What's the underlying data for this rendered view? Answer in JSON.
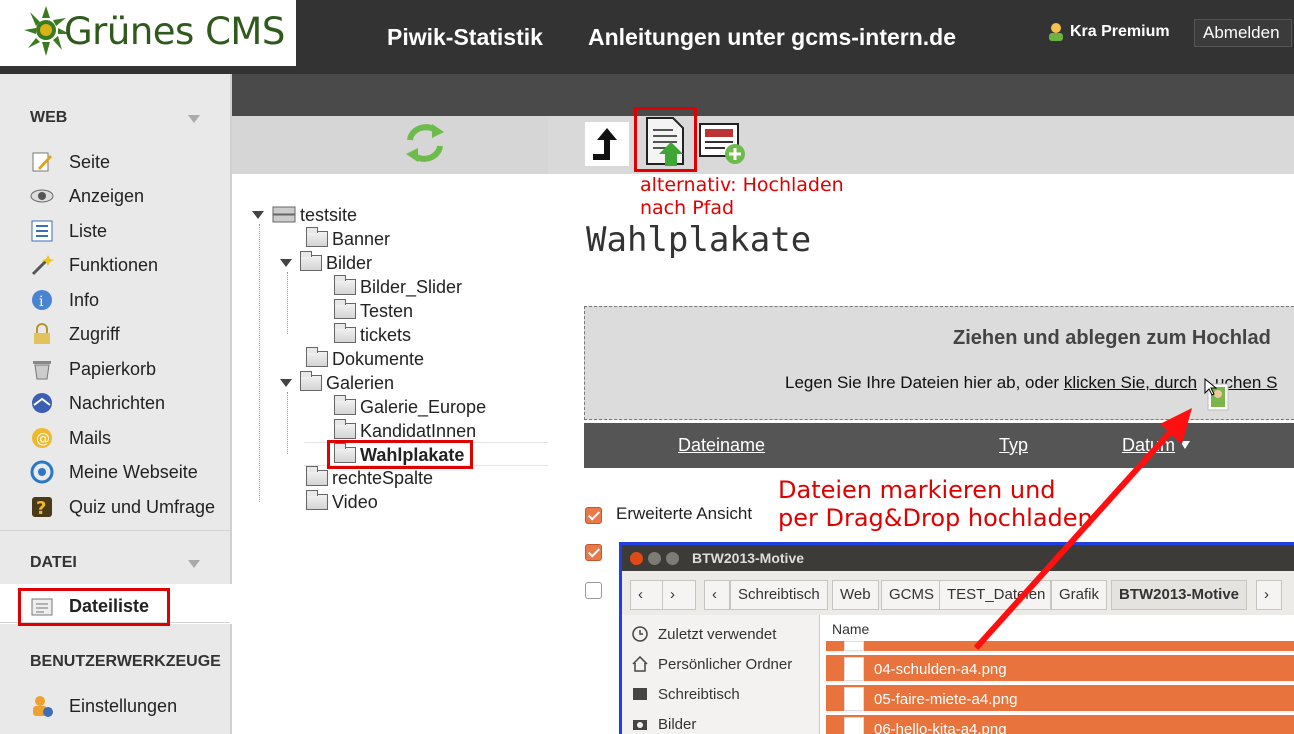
{
  "header": {
    "logo_text": "Grünes CMS",
    "nav": [
      "Piwik-Statistik",
      "Anleitungen unter gcms-intern.de"
    ],
    "user": "Kra Premium",
    "logout": "Abmelden"
  },
  "sidebar": {
    "section_web": "WEB",
    "web_items": [
      "Seite",
      "Anzeigen",
      "Liste",
      "Funktionen",
      "Info",
      "Zugriff",
      "Papierkorb",
      "Nachrichten",
      "Mails",
      "Meine Webseite",
      "Quiz und Umfrage"
    ],
    "section_datei": "DATEI",
    "datei_items": [
      "Dateiliste"
    ],
    "section_tools": "BENUTZERWERKZEUGE",
    "tools_items": [
      "Einstellungen"
    ]
  },
  "tree": {
    "root": "testsite",
    "items": [
      "Banner",
      "Bilder",
      "Bilder_Slider",
      "Testen",
      "tickets",
      "Dokumente",
      "Galerien",
      "Galerie_Europe",
      "KandidatInnen",
      "Wahlplakate",
      "rechteSpalte",
      "Video"
    ]
  },
  "annotations": {
    "upload_path_1": "alternativ: Hochladen",
    "upload_path_2": "nach Pfad",
    "drag_1": "Dateien markieren und",
    "drag_2": "per Drag&Drop hochladen"
  },
  "content": {
    "title": "Wahlplakate",
    "dropzone_title": "Ziehen und ablegen zum Hochlad",
    "dropzone_text_prefix": "Legen Sie Ihre Dateien hier ab, oder ",
    "dropzone_link": "klicken Sie, durch",
    "dropzone_link_end": "uchen S",
    "table_headers": [
      "Dateiname",
      "Typ",
      "Datum"
    ],
    "extended_view": "Erweiterte Ansicht"
  },
  "file_manager": {
    "title": "BTW2013-Motive",
    "breadcrumbs": [
      "Schreibtisch",
      "Web",
      "GCMS",
      "TEST_Dateien",
      "Grafik",
      "BTW2013-Motive"
    ],
    "places": [
      "Zuletzt verwendet",
      "Persönlicher Ordner",
      "Schreibtisch",
      "Bilder"
    ],
    "column": "Name",
    "files": [
      "04-schulden-a4.png",
      "05-faire-miete-a4.png",
      "06-hello-kita-a4.png"
    ]
  },
  "colors": {
    "header_bg": "#333333",
    "accent_red": "#e00000",
    "selection_orange": "#e9733d",
    "logo_green": "#2e5a1c"
  }
}
